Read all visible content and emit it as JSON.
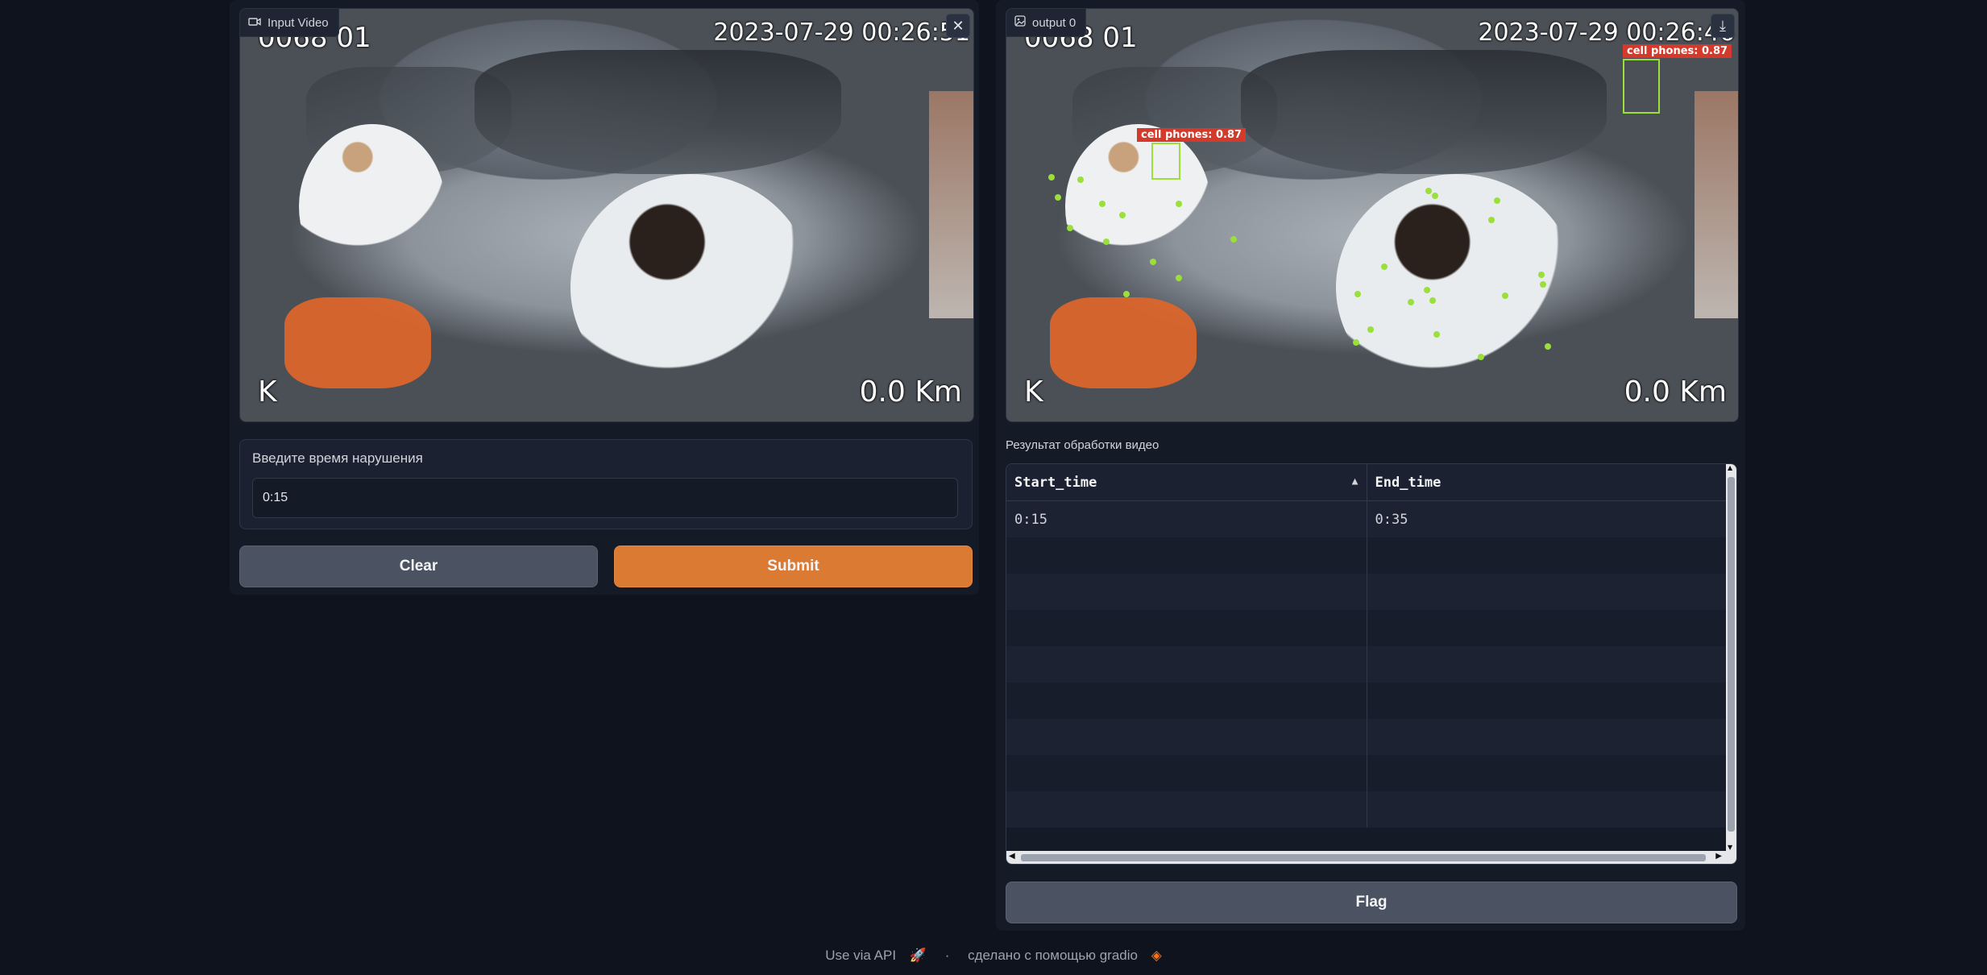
{
  "input_video": {
    "label": "Input Video",
    "osd": {
      "top_left": "0068 01",
      "top_right": "2023-07-29 00:26:51",
      "bottom_left": "K",
      "bottom_right": "0.0 Km"
    }
  },
  "output_video": {
    "label": "output 0",
    "osd": {
      "top_left": "0068 01",
      "top_right": "2023-07-29 00:26:46",
      "bottom_left": "K",
      "bottom_right": "0.0 Km"
    },
    "detections": [
      {
        "label": "cell phones: 0.87"
      },
      {
        "label": "cell phones: 0.87"
      }
    ]
  },
  "violation_time": {
    "label": "Введите время нарушения",
    "value": "0:15"
  },
  "buttons": {
    "clear": "Clear",
    "submit": "Submit",
    "flag": "Flag"
  },
  "results": {
    "title": "Результат обработки видео",
    "columns": [
      "Start_time",
      "End_time"
    ],
    "rows": [
      [
        "0:15",
        "0:35"
      ]
    ]
  },
  "footer": {
    "api": "Use via API",
    "separator": "·",
    "made_with": "сделано с помощью gradio"
  },
  "colors": {
    "accent": "#db7a33",
    "background": "#0f131d",
    "detection_box": "#9adf3a",
    "detection_label": "#d43a2b"
  }
}
